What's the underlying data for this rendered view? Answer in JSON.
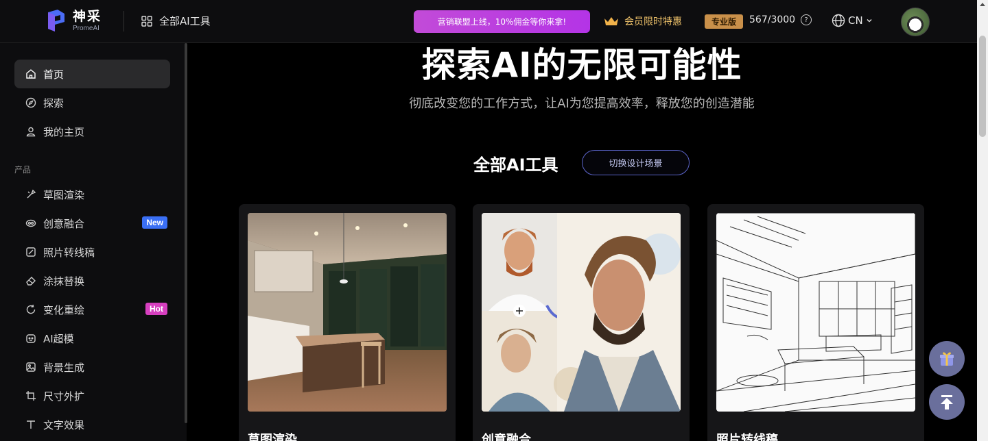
{
  "header": {
    "logo_cn": "神采",
    "logo_en": "PromeAI",
    "all_tools": "全部AI工具",
    "promo": "营销联盟上线，10%佣金等你来拿!",
    "vip": "会员限时特惠",
    "pro_badge": "专业版",
    "credits": "567/3000",
    "lang": "CN"
  },
  "sidebar": {
    "top_items": [
      {
        "label": "首页",
        "icon": "home-icon"
      },
      {
        "label": "探索",
        "icon": "compass-icon"
      },
      {
        "label": "我的主页",
        "icon": "user-icon"
      }
    ],
    "section_label": "产品",
    "product_items": [
      {
        "label": "草图渲染",
        "icon": "sketch-icon"
      },
      {
        "label": "创意融合",
        "icon": "blend-icon",
        "tag": "New"
      },
      {
        "label": "照片转线稿",
        "icon": "edit-icon"
      },
      {
        "label": "涂抹替换",
        "icon": "eraser-icon"
      },
      {
        "label": "变化重绘",
        "icon": "refresh-icon",
        "tag": "Hot"
      },
      {
        "label": "AI超模",
        "icon": "robot-icon"
      },
      {
        "label": "背景生成",
        "icon": "image-icon"
      },
      {
        "label": "尺寸外扩",
        "icon": "crop-icon"
      },
      {
        "label": "文字效果",
        "icon": "text-icon"
      }
    ]
  },
  "main": {
    "hero_title": "探索AI的无限可能性",
    "hero_subtitle": "彻底改变您的工作方式，让AI为您提高效率，释放您的创造潜能",
    "section_title": "全部AI工具",
    "switch_button": "切换设计场景",
    "cards": [
      {
        "title": "草图渲染"
      },
      {
        "title": "创意融合"
      },
      {
        "title": "照片转线稿"
      }
    ]
  },
  "colors": {
    "promo_gradient": [
      "#c24bd8",
      "#b434e6"
    ],
    "vip_gold": "#f1c46b",
    "pro_badge": "#c9904a",
    "tag_new": "#3a6ff5",
    "tag_hot": "#d63fbf"
  }
}
